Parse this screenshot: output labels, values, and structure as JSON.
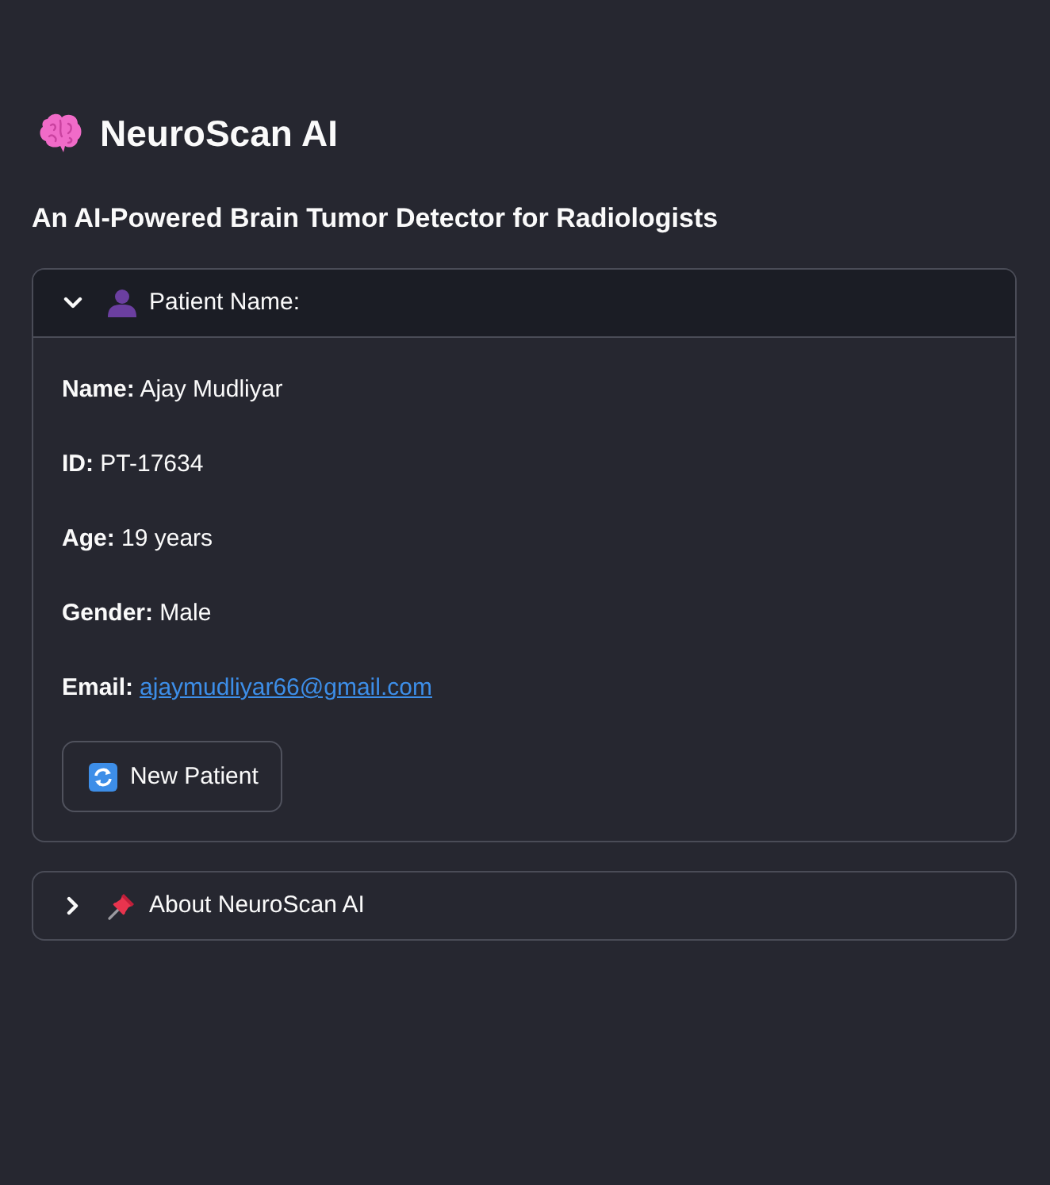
{
  "page": {
    "title": "NeuroScan AI",
    "subtitle": "An AI-Powered Brain Tumor Detector for Radiologists"
  },
  "expanders": [
    {
      "label": "Patient Name:",
      "expanded": true,
      "fields": [
        {
          "kind": "text",
          "text": "**Name:** Ajay Mudliyar"
        },
        {
          "kind": "text",
          "text": "**ID:** PT-17634"
        },
        {
          "kind": "text",
          "text": "**Age:** 19 years"
        },
        {
          "kind": "text",
          "text": "**Gender:** Male"
        },
        {
          "kind": "link",
          "label": "Email:",
          "link": "ajaymudliyar66@gmail.com"
        }
      ],
      "button": {
        "label": "New Patient"
      }
    },
    {
      "label": "About NeuroScan AI",
      "expanded": false
    }
  ]
}
